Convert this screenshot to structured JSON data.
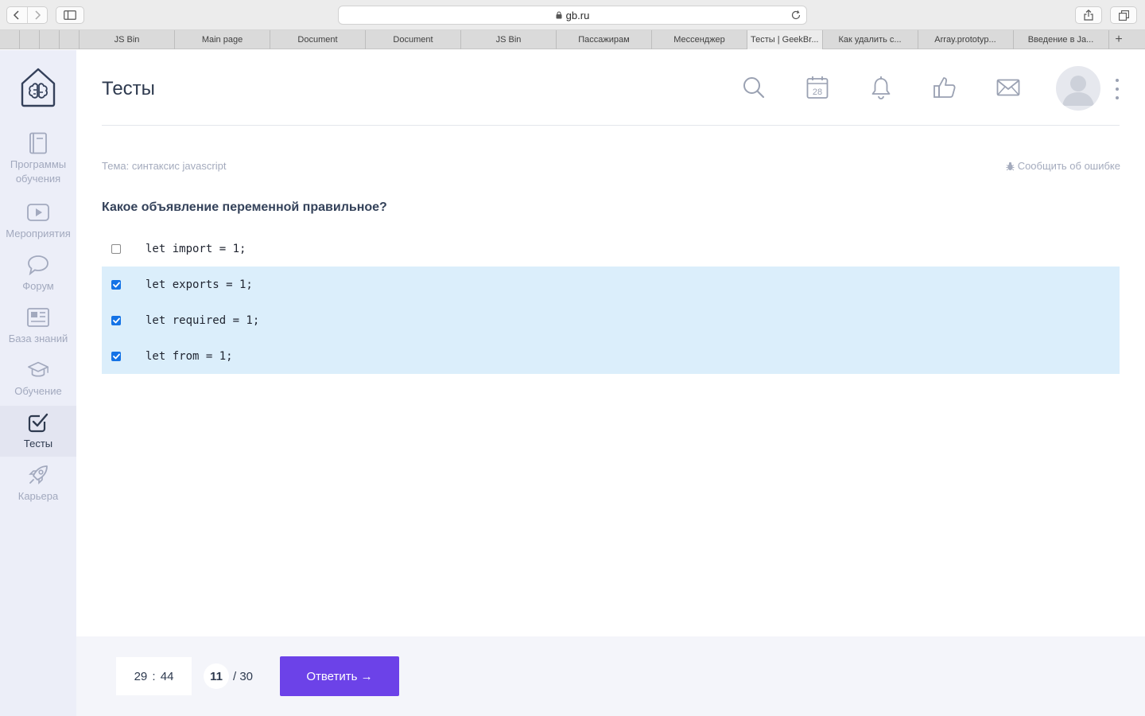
{
  "browser": {
    "url": "gb.ru",
    "tabs": [
      {
        "label": "",
        "kind": "pinned"
      },
      {
        "label": "",
        "kind": "pinned"
      },
      {
        "label": "",
        "kind": "pinned"
      },
      {
        "label": "",
        "kind": "pinned"
      },
      {
        "label": "JS Bin",
        "kind": "normal"
      },
      {
        "label": "Main page",
        "kind": "normal"
      },
      {
        "label": "Document",
        "kind": "normal"
      },
      {
        "label": "Document",
        "kind": "normal"
      },
      {
        "label": "JS Bin",
        "kind": "normal"
      },
      {
        "label": "Пассажирам",
        "kind": "normal"
      },
      {
        "label": "Мессенджер",
        "kind": "normal"
      },
      {
        "label": "Тесты | GeekBr...",
        "kind": "active"
      },
      {
        "label": "Как удалить с...",
        "kind": "normal"
      },
      {
        "label": "Array.prototyp...",
        "kind": "normal"
      },
      {
        "label": "Введение в Ja...",
        "kind": "normal"
      }
    ],
    "new_tab_label": "+"
  },
  "sidebar": {
    "items": [
      {
        "label": "Программы обучения",
        "icon": "book-icon",
        "active": false
      },
      {
        "label": "Мероприятия",
        "icon": "play-icon",
        "active": false
      },
      {
        "label": "Форум",
        "icon": "chat-bubble-icon",
        "active": false
      },
      {
        "label": "База знаний",
        "icon": "newspaper-icon",
        "active": false
      },
      {
        "label": "Обучение",
        "icon": "graduation-cap-icon",
        "active": false
      },
      {
        "label": "Тесты",
        "icon": "checkbox-icon",
        "active": true
      },
      {
        "label": "Карьера",
        "icon": "rocket-icon",
        "active": false
      }
    ]
  },
  "header": {
    "title": "Тесты",
    "calendar_day": "28",
    "icons": [
      "search-icon",
      "calendar-icon",
      "bell-icon",
      "thumbs-up-icon",
      "mail-icon",
      "avatar",
      "more-icon"
    ]
  },
  "test": {
    "topic": "Тема: синтаксис javascript",
    "report_label": "Сообщить об ошибке",
    "question": "Какое объявление переменной правильное?",
    "answers": [
      {
        "code": "let import = 1;",
        "checked": false
      },
      {
        "code": "let exports = 1;",
        "checked": true
      },
      {
        "code": "let required = 1;",
        "checked": true
      },
      {
        "code": "let from = 1;",
        "checked": true
      }
    ]
  },
  "footer": {
    "timer": "29 : 44",
    "current_question": "11",
    "total_label": "/ 30",
    "submit_label": "Ответить →"
  },
  "colors": {
    "accent": "#6c42e8",
    "selected_row": "#dbeefb",
    "checkbox": "#1473e6",
    "sidebar_bg": "#eceef8",
    "footer_bg": "#f4f5fa"
  }
}
